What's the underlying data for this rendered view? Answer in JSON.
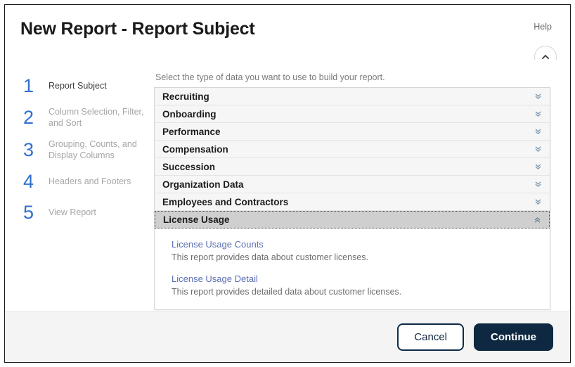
{
  "header": {
    "title": "New Report - Report Subject",
    "help_label": "Help",
    "collapse_icon": "chevron-up-icon"
  },
  "steps": [
    {
      "number": "1",
      "label": "Report Subject",
      "active": true
    },
    {
      "number": "2",
      "label": "Column Selection, Filter, and Sort",
      "active": false
    },
    {
      "number": "3",
      "label": "Grouping, Counts, and Display Columns",
      "active": false
    },
    {
      "number": "4",
      "label": "Headers and Footers",
      "active": false
    },
    {
      "number": "5",
      "label": "View Report",
      "active": false
    }
  ],
  "main": {
    "caption": "Select the type of data you want to use to build your report.",
    "accordion": [
      {
        "label": "Recruiting",
        "expanded": false,
        "icon": "double-chevron-down-icon"
      },
      {
        "label": "Onboarding",
        "expanded": false,
        "icon": "double-chevron-down-icon"
      },
      {
        "label": "Performance",
        "expanded": false,
        "icon": "double-chevron-down-icon"
      },
      {
        "label": "Compensation",
        "expanded": false,
        "icon": "double-chevron-down-icon"
      },
      {
        "label": "Succession",
        "expanded": false,
        "icon": "double-chevron-down-icon"
      },
      {
        "label": "Organization Data",
        "expanded": false,
        "icon": "double-chevron-down-icon"
      },
      {
        "label": "Employees and Contractors",
        "expanded": false,
        "icon": "double-chevron-down-icon"
      },
      {
        "label": "License Usage",
        "expanded": true,
        "icon": "double-chevron-up-icon"
      }
    ],
    "reports": [
      {
        "link": "License Usage Counts",
        "description": "This report provides data about customer licenses."
      },
      {
        "link": "License Usage Detail",
        "description": "This report provides detailed data about customer licenses."
      }
    ]
  },
  "footer": {
    "cancel_label": "Cancel",
    "continue_label": "Continue"
  },
  "colors": {
    "step_number": "#2f6fd0",
    "link": "#5b6fb5",
    "primary_button": "#0d2840",
    "selected_row": "#cfcfcf",
    "row": "#f6f6f6",
    "footer": "#f4f4f4"
  }
}
